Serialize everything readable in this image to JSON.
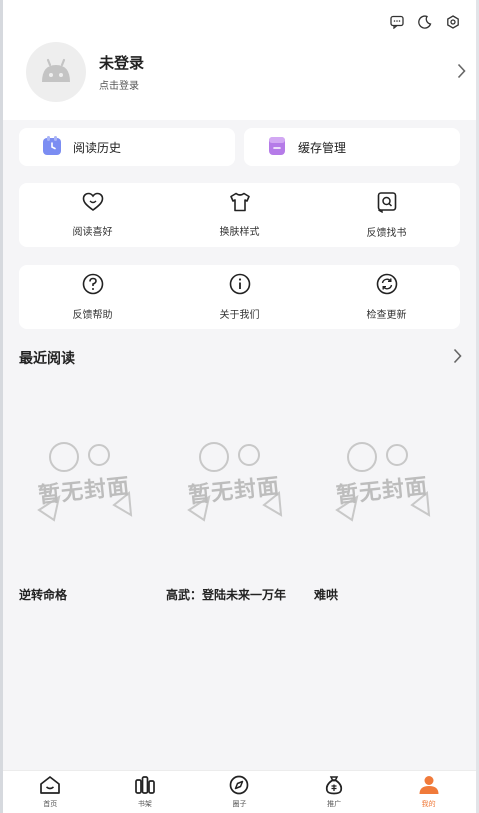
{
  "header": {
    "user_name": "未登录",
    "user_sub": "点击登录",
    "icons": [
      "message-icon",
      "night-mode-icon",
      "settings-icon"
    ]
  },
  "quick_actions": [
    {
      "label": "阅读历史",
      "icon": "history-icon"
    },
    {
      "label": "缓存管理",
      "icon": "cache-icon"
    }
  ],
  "grid1": [
    {
      "label": "阅读喜好",
      "icon": "heart-icon"
    },
    {
      "label": "换肤样式",
      "icon": "shirt-icon"
    },
    {
      "label": "反馈找书",
      "icon": "search-book-icon"
    }
  ],
  "grid2": [
    {
      "label": "反馈帮助",
      "icon": "help-icon"
    },
    {
      "label": "关于我们",
      "icon": "info-icon"
    },
    {
      "label": "检查更新",
      "icon": "refresh-icon"
    }
  ],
  "recent": {
    "title": "最近阅读",
    "cover_placeholder": "暂无封面",
    "books": [
      "逆转命格",
      "高武：登陆未来一万年",
      "难哄"
    ]
  },
  "tabbar": [
    {
      "label": "首页",
      "icon": "home-icon"
    },
    {
      "label": "书架",
      "icon": "bookshelf-icon"
    },
    {
      "label": "圈子",
      "icon": "compass-icon"
    },
    {
      "label": "推广",
      "icon": "money-bag-icon"
    },
    {
      "label": "我的",
      "icon": "profile-icon",
      "active": true
    }
  ],
  "colors": {
    "accent": "#f07a3a",
    "history_icon": "#7b8df2",
    "cache_icon": "#b57be8"
  }
}
